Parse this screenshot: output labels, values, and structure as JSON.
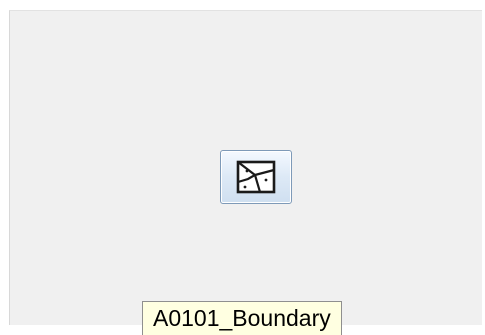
{
  "item": {
    "icon": "polygon-boundary-icon",
    "label": "A0101_Boundary"
  },
  "colors": {
    "background": "#f0f0f0",
    "button_border": "#7e9ab8",
    "label_background": "#ffffe1"
  }
}
